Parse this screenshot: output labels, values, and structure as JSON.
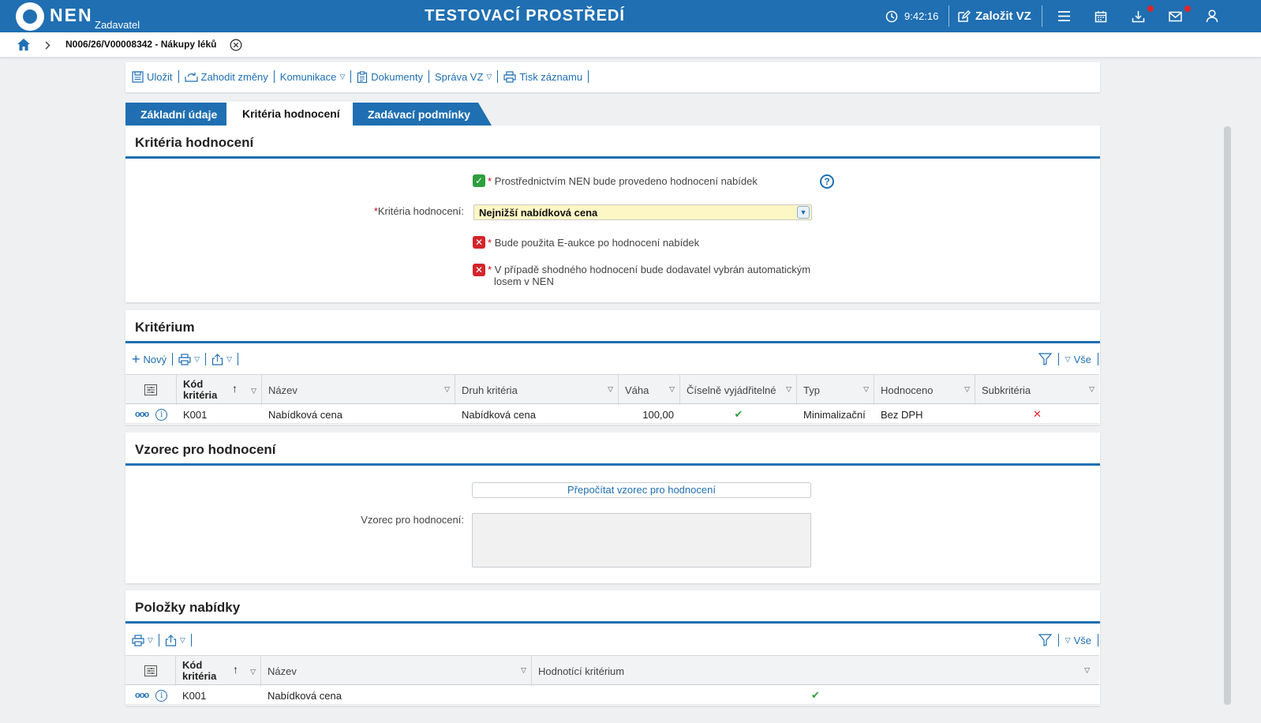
{
  "topbar": {
    "logo_text": "NEN",
    "logo_sub": "Zadavatel",
    "env_title": "TESTOVACÍ PROSTŘEDÍ",
    "time": "9:42:16",
    "create_label": "Založit VZ"
  },
  "breadcrumb": {
    "title": "N006/26/V00008342 - Nákupy léků"
  },
  "toolbar": {
    "save": "Uložit",
    "discard": "Zahodit změny",
    "communication": "Komunikace",
    "documents": "Dokumenty",
    "manage": "Správa VZ",
    "print": "Tisk záznamu"
  },
  "tabs": {
    "basic": "Základní údaje",
    "criteria": "Kritéria hodnocení",
    "conditions": "Zadávací podmínky"
  },
  "criteria_panel": {
    "title": "Kritéria hodnocení",
    "cb1_text": "Prostřednictvím NEN bude provedeno hodnocení nabídek",
    "cb1_checked": true,
    "select_label": "Kritéria hodnocení:",
    "select_value": "Nejnižší nabídková cena",
    "cb2_text": "Bude použita E-aukce po hodnocení nabídek",
    "cb2_checked": false,
    "cb3_text_line1": "V případě shodného hodnocení bude dodavatel vybrán automatickým",
    "cb3_text_line2": "losem v NEN",
    "cb3_checked": false
  },
  "kriterium_panel": {
    "title": "Kritérium",
    "new_label": "Nový",
    "all_label": "Vše",
    "headers": {
      "code_line1": "Kód",
      "code_line2": "kritéria",
      "name": "Název",
      "kind": "Druh kritéria",
      "weight": "Váha",
      "numeric": "Číselně vyjádřitelné",
      "type": "Typ",
      "evaluated": "Hodnoceno",
      "sub": "Subkritéria"
    },
    "rows": [
      {
        "code": "K001",
        "name": "Nabídková cena",
        "kind": "Nabídková cena",
        "weight": "100,00",
        "numeric": true,
        "type": "Minimalizační",
        "evaluated": "Bez DPH",
        "sub": false
      }
    ]
  },
  "formula_panel": {
    "title": "Vzorec pro hodnocení",
    "recalc_button": "Přepočítat vzorec pro hodnocení",
    "formula_label": "Vzorec pro hodnocení:",
    "formula_value": ""
  },
  "items_panel": {
    "title": "Položky nabídky",
    "all_label": "Vše",
    "headers": {
      "code_line1": "Kód",
      "code_line2": "kritéria",
      "name": "Název",
      "criterion": "Hodnotící kritérium"
    },
    "rows": [
      {
        "code": "K001",
        "name": "Nabídková cena",
        "criterion": true
      }
    ]
  }
}
